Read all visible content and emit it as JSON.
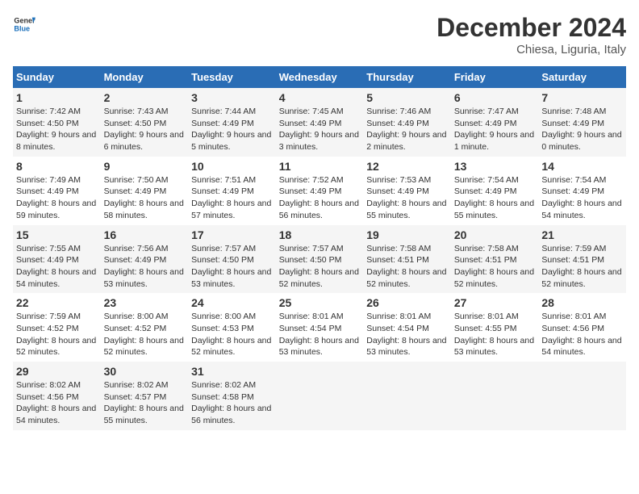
{
  "header": {
    "logo_general": "General",
    "logo_blue": "Blue",
    "title": "December 2024",
    "subtitle": "Chiesa, Liguria, Italy"
  },
  "days_of_week": [
    "Sunday",
    "Monday",
    "Tuesday",
    "Wednesday",
    "Thursday",
    "Friday",
    "Saturday"
  ],
  "weeks": [
    [
      {
        "day": "1",
        "sunrise": "Sunrise: 7:42 AM",
        "sunset": "Sunset: 4:50 PM",
        "daylight": "Daylight: 9 hours and 8 minutes."
      },
      {
        "day": "2",
        "sunrise": "Sunrise: 7:43 AM",
        "sunset": "Sunset: 4:50 PM",
        "daylight": "Daylight: 9 hours and 6 minutes."
      },
      {
        "day": "3",
        "sunrise": "Sunrise: 7:44 AM",
        "sunset": "Sunset: 4:49 PM",
        "daylight": "Daylight: 9 hours and 5 minutes."
      },
      {
        "day": "4",
        "sunrise": "Sunrise: 7:45 AM",
        "sunset": "Sunset: 4:49 PM",
        "daylight": "Daylight: 9 hours and 3 minutes."
      },
      {
        "day": "5",
        "sunrise": "Sunrise: 7:46 AM",
        "sunset": "Sunset: 4:49 PM",
        "daylight": "Daylight: 9 hours and 2 minutes."
      },
      {
        "day": "6",
        "sunrise": "Sunrise: 7:47 AM",
        "sunset": "Sunset: 4:49 PM",
        "daylight": "Daylight: 9 hours and 1 minute."
      },
      {
        "day": "7",
        "sunrise": "Sunrise: 7:48 AM",
        "sunset": "Sunset: 4:49 PM",
        "daylight": "Daylight: 9 hours and 0 minutes."
      }
    ],
    [
      {
        "day": "8",
        "sunrise": "Sunrise: 7:49 AM",
        "sunset": "Sunset: 4:49 PM",
        "daylight": "Daylight: 8 hours and 59 minutes."
      },
      {
        "day": "9",
        "sunrise": "Sunrise: 7:50 AM",
        "sunset": "Sunset: 4:49 PM",
        "daylight": "Daylight: 8 hours and 58 minutes."
      },
      {
        "day": "10",
        "sunrise": "Sunrise: 7:51 AM",
        "sunset": "Sunset: 4:49 PM",
        "daylight": "Daylight: 8 hours and 57 minutes."
      },
      {
        "day": "11",
        "sunrise": "Sunrise: 7:52 AM",
        "sunset": "Sunset: 4:49 PM",
        "daylight": "Daylight: 8 hours and 56 minutes."
      },
      {
        "day": "12",
        "sunrise": "Sunrise: 7:53 AM",
        "sunset": "Sunset: 4:49 PM",
        "daylight": "Daylight: 8 hours and 55 minutes."
      },
      {
        "day": "13",
        "sunrise": "Sunrise: 7:54 AM",
        "sunset": "Sunset: 4:49 PM",
        "daylight": "Daylight: 8 hours and 55 minutes."
      },
      {
        "day": "14",
        "sunrise": "Sunrise: 7:54 AM",
        "sunset": "Sunset: 4:49 PM",
        "daylight": "Daylight: 8 hours and 54 minutes."
      }
    ],
    [
      {
        "day": "15",
        "sunrise": "Sunrise: 7:55 AM",
        "sunset": "Sunset: 4:49 PM",
        "daylight": "Daylight: 8 hours and 54 minutes."
      },
      {
        "day": "16",
        "sunrise": "Sunrise: 7:56 AM",
        "sunset": "Sunset: 4:49 PM",
        "daylight": "Daylight: 8 hours and 53 minutes."
      },
      {
        "day": "17",
        "sunrise": "Sunrise: 7:57 AM",
        "sunset": "Sunset: 4:50 PM",
        "daylight": "Daylight: 8 hours and 53 minutes."
      },
      {
        "day": "18",
        "sunrise": "Sunrise: 7:57 AM",
        "sunset": "Sunset: 4:50 PM",
        "daylight": "Daylight: 8 hours and 52 minutes."
      },
      {
        "day": "19",
        "sunrise": "Sunrise: 7:58 AM",
        "sunset": "Sunset: 4:51 PM",
        "daylight": "Daylight: 8 hours and 52 minutes."
      },
      {
        "day": "20",
        "sunrise": "Sunrise: 7:58 AM",
        "sunset": "Sunset: 4:51 PM",
        "daylight": "Daylight: 8 hours and 52 minutes."
      },
      {
        "day": "21",
        "sunrise": "Sunrise: 7:59 AM",
        "sunset": "Sunset: 4:51 PM",
        "daylight": "Daylight: 8 hours and 52 minutes."
      }
    ],
    [
      {
        "day": "22",
        "sunrise": "Sunrise: 7:59 AM",
        "sunset": "Sunset: 4:52 PM",
        "daylight": "Daylight: 8 hours and 52 minutes."
      },
      {
        "day": "23",
        "sunrise": "Sunrise: 8:00 AM",
        "sunset": "Sunset: 4:52 PM",
        "daylight": "Daylight: 8 hours and 52 minutes."
      },
      {
        "day": "24",
        "sunrise": "Sunrise: 8:00 AM",
        "sunset": "Sunset: 4:53 PM",
        "daylight": "Daylight: 8 hours and 52 minutes."
      },
      {
        "day": "25",
        "sunrise": "Sunrise: 8:01 AM",
        "sunset": "Sunset: 4:54 PM",
        "daylight": "Daylight: 8 hours and 53 minutes."
      },
      {
        "day": "26",
        "sunrise": "Sunrise: 8:01 AM",
        "sunset": "Sunset: 4:54 PM",
        "daylight": "Daylight: 8 hours and 53 minutes."
      },
      {
        "day": "27",
        "sunrise": "Sunrise: 8:01 AM",
        "sunset": "Sunset: 4:55 PM",
        "daylight": "Daylight: 8 hours and 53 minutes."
      },
      {
        "day": "28",
        "sunrise": "Sunrise: 8:01 AM",
        "sunset": "Sunset: 4:56 PM",
        "daylight": "Daylight: 8 hours and 54 minutes."
      }
    ],
    [
      {
        "day": "29",
        "sunrise": "Sunrise: 8:02 AM",
        "sunset": "Sunset: 4:56 PM",
        "daylight": "Daylight: 8 hours and 54 minutes."
      },
      {
        "day": "30",
        "sunrise": "Sunrise: 8:02 AM",
        "sunset": "Sunset: 4:57 PM",
        "daylight": "Daylight: 8 hours and 55 minutes."
      },
      {
        "day": "31",
        "sunrise": "Sunrise: 8:02 AM",
        "sunset": "Sunset: 4:58 PM",
        "daylight": "Daylight: 8 hours and 56 minutes."
      },
      null,
      null,
      null,
      null
    ]
  ]
}
